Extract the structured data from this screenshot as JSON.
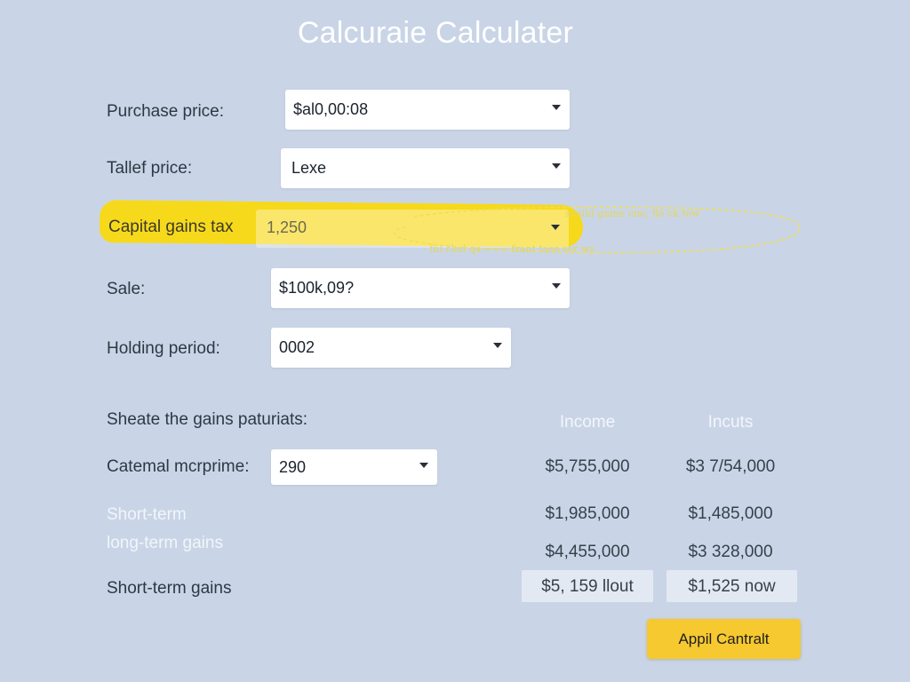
{
  "title": "Calcuraie Calculater",
  "fields": {
    "purchase_price": {
      "label": "Purchase price:",
      "value": "$al0,00:08"
    },
    "tallef_price": {
      "label": "Tallef price:",
      "value": "Lexe"
    },
    "capital_gains_tax": {
      "label": "Capital gains tax",
      "value": "1,250"
    },
    "sale": {
      "label": "Sale:",
      "value": "$100k,09?"
    },
    "holding_period": {
      "label": "Holding period:",
      "value": "0002"
    },
    "catemal": {
      "label": "Catemal mcrprime:",
      "value": "290"
    }
  },
  "scribble_text": {
    "line1": "seaild gaine one, flé ck tew",
    "line2": "- fni clad qs ~~~ frant tase ser ws"
  },
  "gains_section": {
    "heading": "Sheate the gains paturiats:",
    "columns": [
      "Income",
      "Incuts"
    ],
    "rows": [
      {
        "label": "",
        "values": [
          "$5,755,000",
          "$3 7/54,000"
        ]
      },
      {
        "label": "Short-term",
        "values": [
          "$1,985,000",
          "$1,485,000"
        ]
      },
      {
        "label": "long-term gains",
        "values": [
          "$4,455,000",
          "$3 328,000"
        ]
      },
      {
        "label": "Short-term gains",
        "values": [
          "$5, 159 llout",
          "$1,525 now"
        ]
      }
    ]
  },
  "apply_button": {
    "label": "Appil Cantralt"
  },
  "colors": {
    "background": "#c9d5e6",
    "highlight": "#f7d91c",
    "button": "#f6c930"
  },
  "icons": {
    "select_caret": "chevron-down-icon"
  }
}
